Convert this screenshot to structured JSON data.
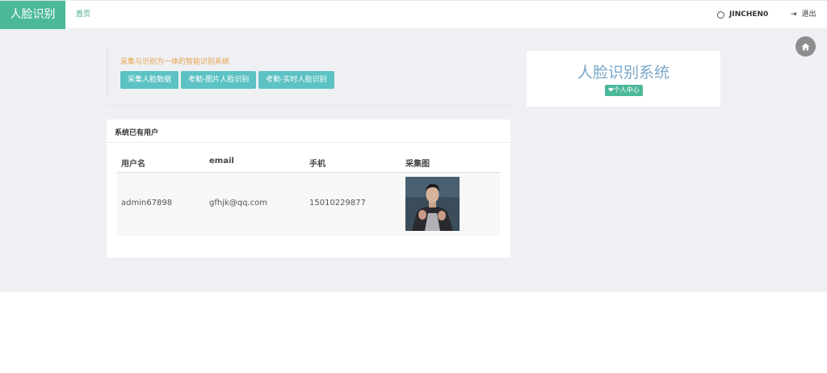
{
  "navbar": {
    "brand": "人脸识别",
    "home_link": "首页",
    "username": "JINCHEN0",
    "logout": "退出"
  },
  "intro": {
    "tagline": "采集与识别为一体的智能识别系统",
    "buttons": [
      "采集人脸数据",
      "考勤-图片人脸识别",
      "考勤-实时人脸识别"
    ]
  },
  "profile": {
    "title": "人脸识别系统",
    "badge": "❤个人中心"
  },
  "users_card": {
    "title": "系统已有用户",
    "columns": [
      "用户名",
      "email",
      "手机",
      "采集图"
    ],
    "rows": [
      {
        "username": "admin67898",
        "email": "gfhjk@qq.com",
        "phone": "15010229877"
      }
    ]
  },
  "colors": {
    "brand": "#4cb89a",
    "button": "#5cc2c4",
    "tagline": "#e8a24a",
    "title": "#7aa7c9"
  },
  "icons": [
    "user-circle-icon",
    "logout-icon",
    "home-icon",
    "heart-icon"
  ]
}
